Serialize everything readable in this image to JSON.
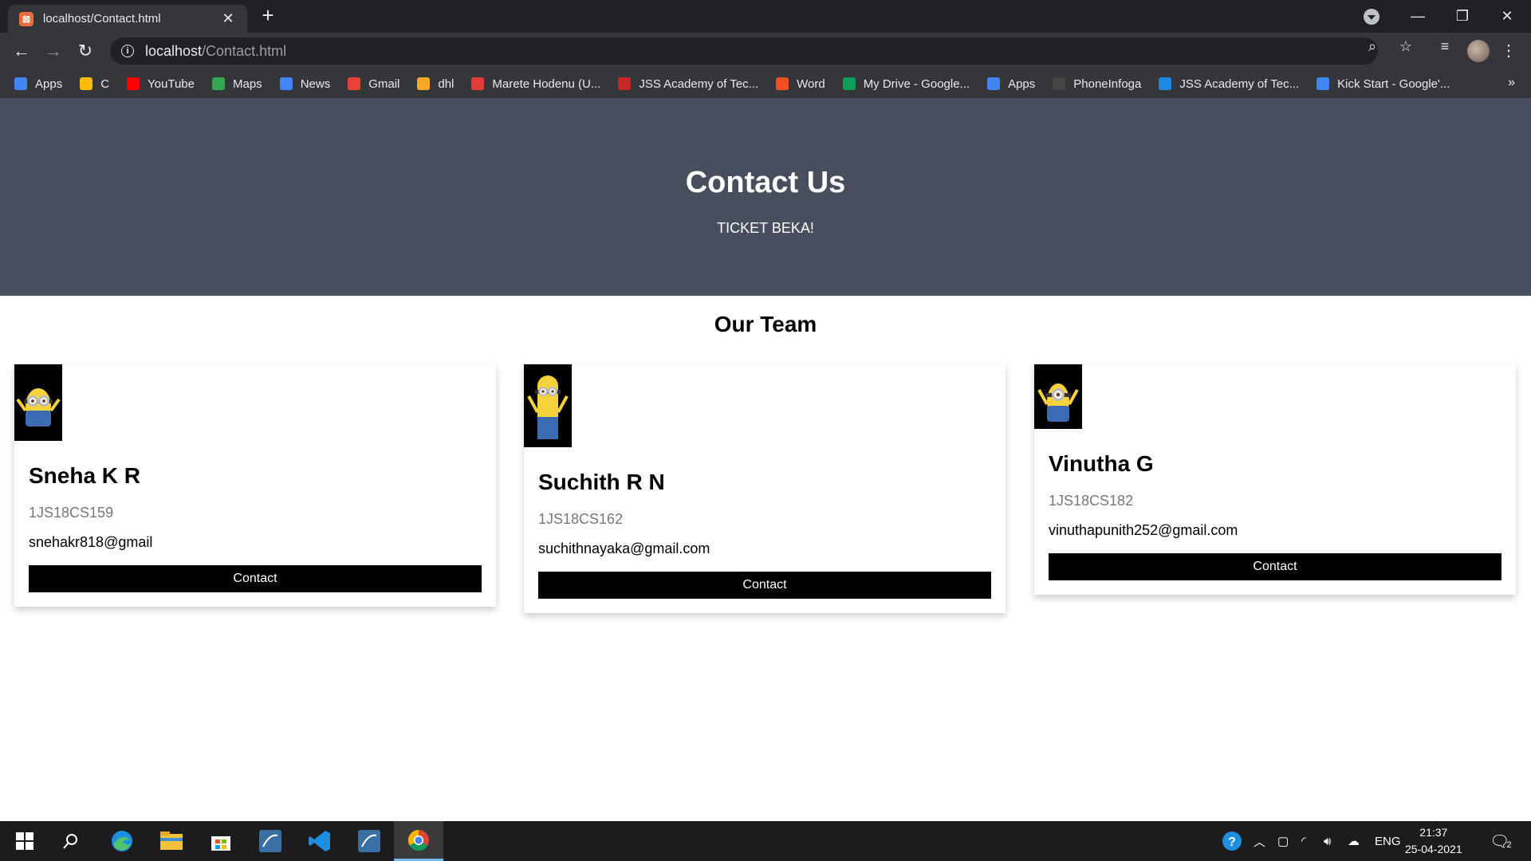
{
  "browser": {
    "tab_title": "localhost/Contact.html",
    "url_host": "localhost",
    "url_path": "/Contact.html"
  },
  "bookmarks": [
    {
      "label": "Apps",
      "icon": "apps-grid-icon",
      "color": "#4285f4"
    },
    {
      "label": "C",
      "icon": "codechef-icon",
      "color": "#fbbc04"
    },
    {
      "label": "YouTube",
      "icon": "youtube-icon",
      "color": "#ff0000"
    },
    {
      "label": "Maps",
      "icon": "maps-icon",
      "color": "#34a853"
    },
    {
      "label": "News",
      "icon": "news-icon",
      "color": "#4285f4"
    },
    {
      "label": "Gmail",
      "icon": "gmail-icon",
      "color": "#ea4335"
    },
    {
      "label": "dhl",
      "icon": "dhl-icon",
      "color": "#f9a825"
    },
    {
      "label": "Marete Hodenu (U...",
      "icon": "music-icon",
      "color": "#e53935"
    },
    {
      "label": "JSS Academy of Tec...",
      "icon": "jss-icon",
      "color": "#c62828"
    },
    {
      "label": "Word",
      "icon": "microsoft-icon",
      "color": "#f25022"
    },
    {
      "label": "My Drive - Google...",
      "icon": "drive-icon",
      "color": "#0f9d58"
    },
    {
      "label": "Apps",
      "icon": "apps-grid-icon",
      "color": "#4285f4"
    },
    {
      "label": "PhoneInfoga",
      "icon": "phoneinfoga-icon",
      "color": "#444444"
    },
    {
      "label": "JSS Academy of Tec...",
      "icon": "jss-s-icon",
      "color": "#1e88e5"
    },
    {
      "label": "Kick Start - Google'...",
      "icon": "google-icon",
      "color": "#4285f4"
    }
  ],
  "hero": {
    "title": "Contact Us",
    "subtitle": "TICKET BEKA!"
  },
  "team": {
    "title": "Our Team",
    "members": [
      {
        "name": "Sneha K R",
        "id": "1JS18CS159",
        "email": "snehakr818@gmail",
        "button": "Contact"
      },
      {
        "name": "Suchith R N",
        "id": "1JS18CS162",
        "email": "suchithnayaka@gmail.com",
        "button": "Contact"
      },
      {
        "name": "Vinutha G",
        "id": "1JS18CS182",
        "email": "vinuthapunith252@gmail.com",
        "button": "Contact"
      }
    ]
  },
  "taskbar": {
    "language": "ENG",
    "time": "21:37",
    "date": "25-04-2021",
    "notification_count": "2"
  }
}
